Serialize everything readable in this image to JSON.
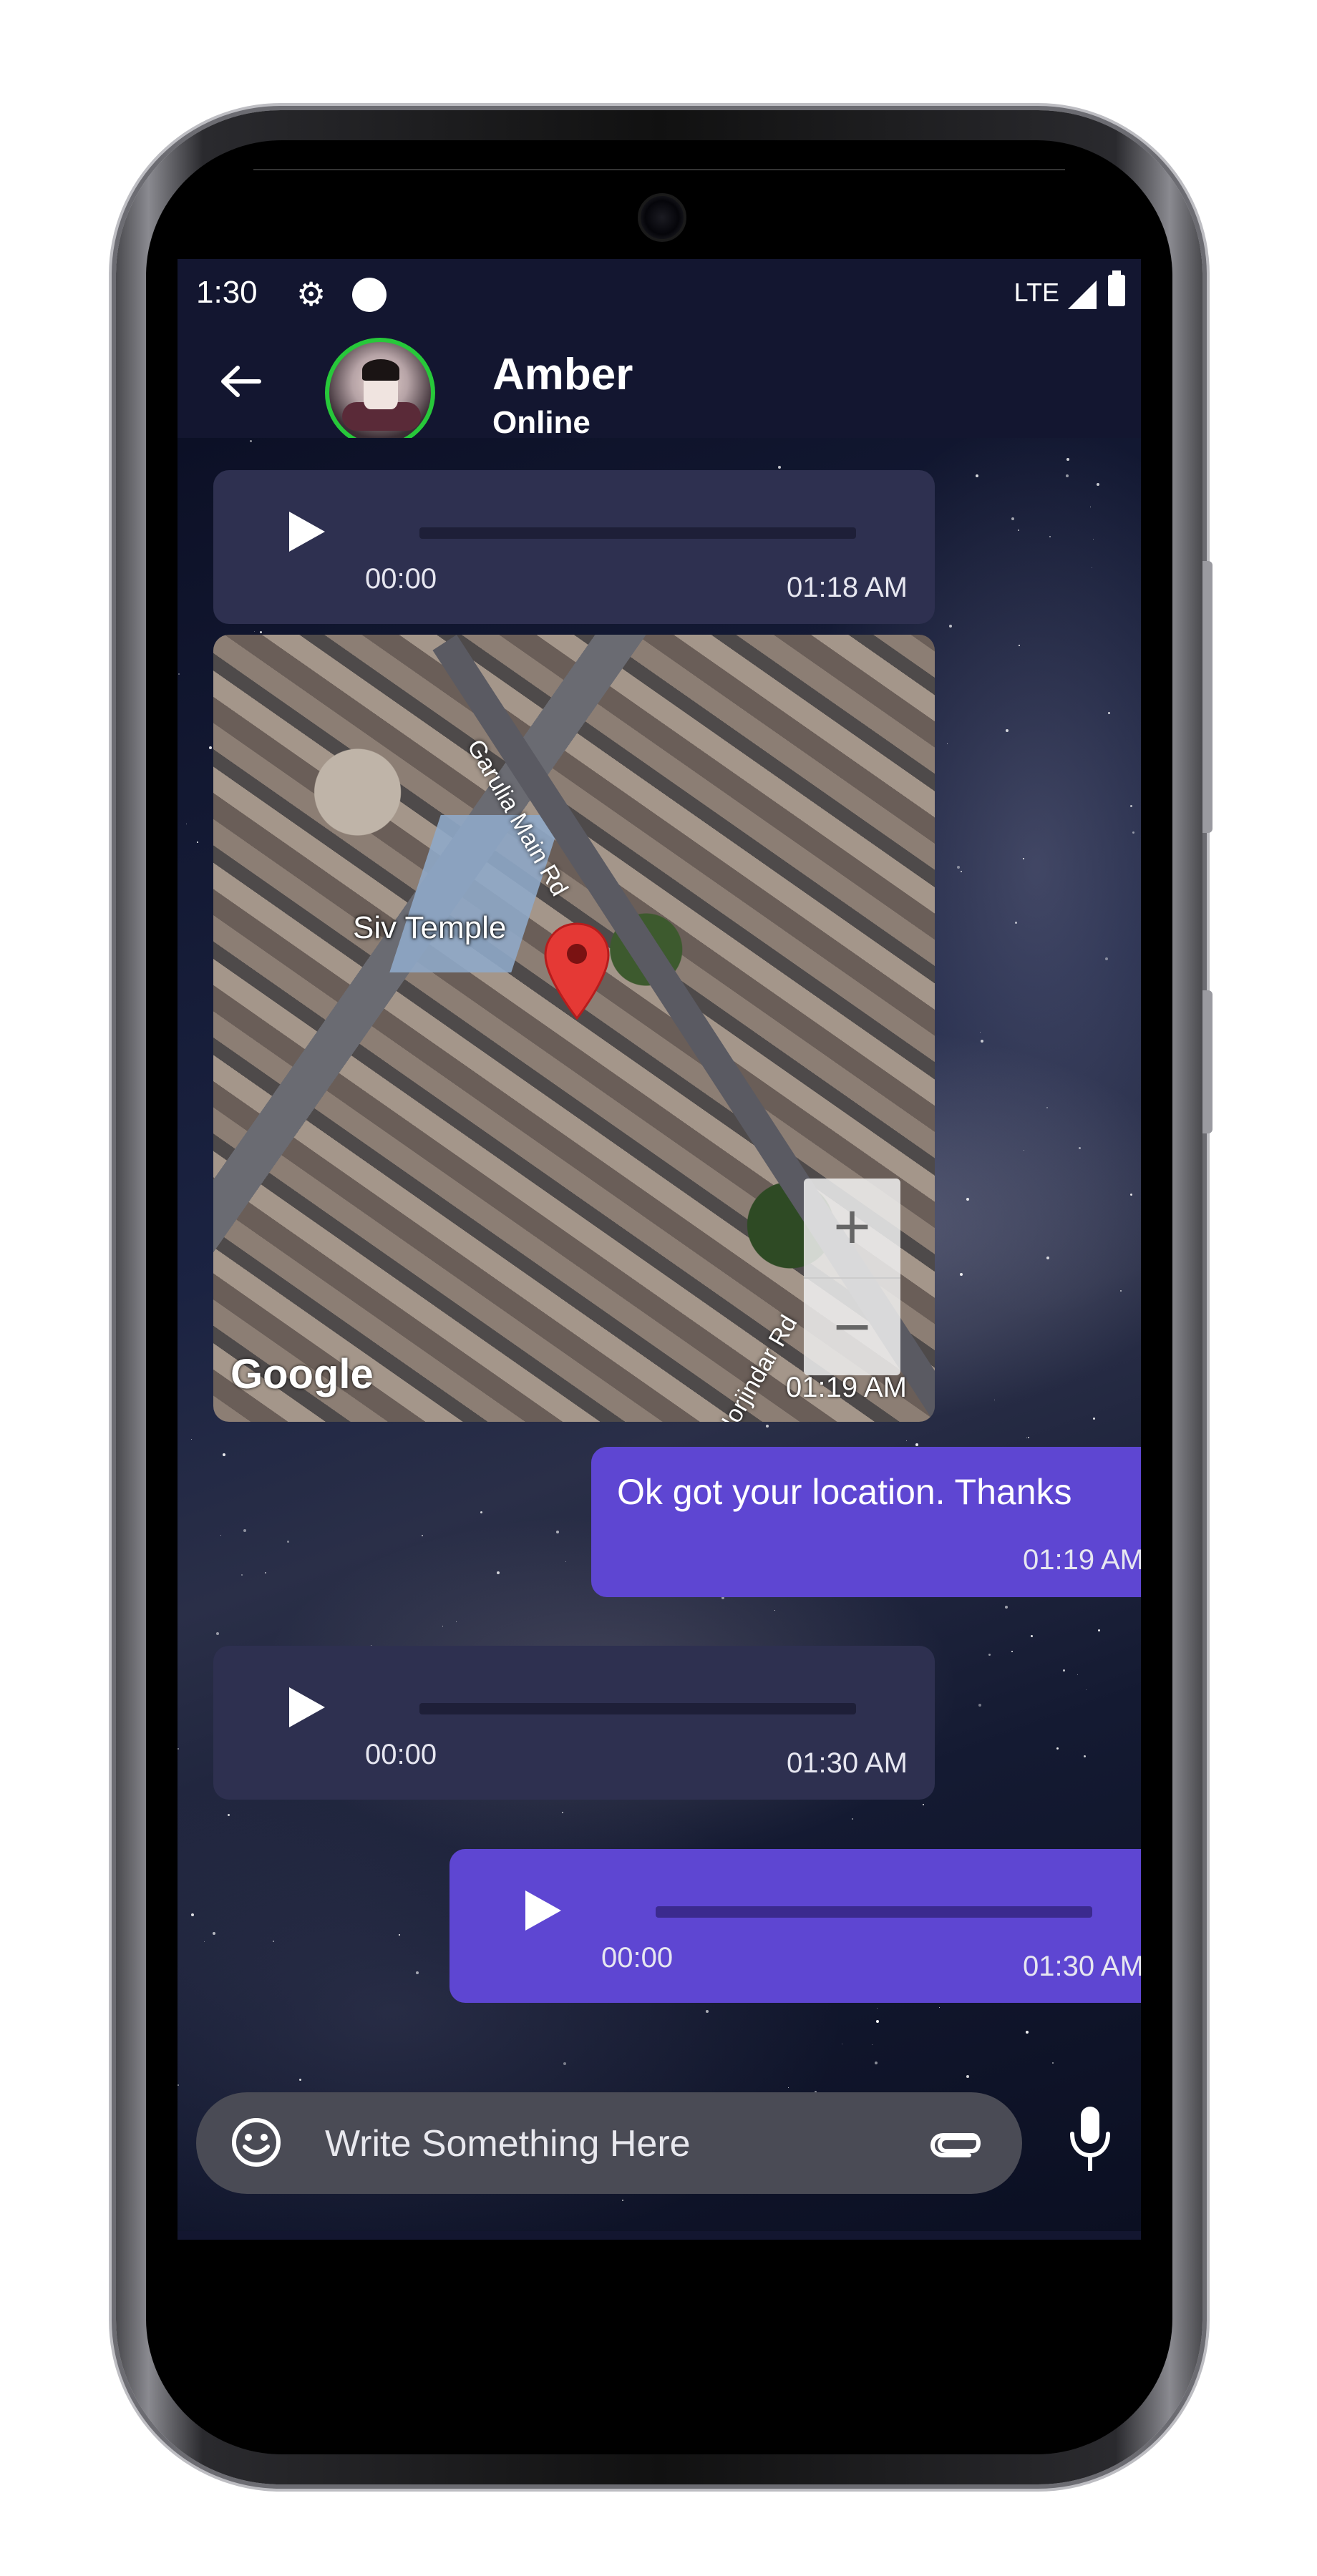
{
  "status_bar": {
    "time": "1:30",
    "network": "LTE"
  },
  "header": {
    "contact_name": "Amber",
    "contact_status": "Online"
  },
  "messages": [
    {
      "type": "voice",
      "direction": "incoming",
      "duration": "00:00",
      "time": "01:18 AM"
    },
    {
      "type": "location",
      "direction": "incoming",
      "place_label": "Siv Temple",
      "road_1": "Garulia Main Rd",
      "road_2": "Horjindar Rd",
      "map_provider": "Google",
      "time": "01:19 AM"
    },
    {
      "type": "text",
      "direction": "outgoing",
      "text": "Ok got your location. Thanks",
      "time": "01:19 AM"
    },
    {
      "type": "voice",
      "direction": "incoming",
      "duration": "00:00",
      "time": "01:30 AM"
    },
    {
      "type": "voice",
      "direction": "outgoing",
      "duration": "00:00",
      "time": "01:30 AM"
    }
  ],
  "composer": {
    "placeholder": "Write Something Here"
  },
  "colors": {
    "incoming_bubble": "#2e3050",
    "outgoing_bubble": "#5e46d2",
    "header": "#131630",
    "online_ring": "#27c83a"
  },
  "icons": {
    "back": "arrow-left-icon",
    "settings": "gear-icon",
    "emoji": "emoji-icon",
    "attach": "paperclip-icon",
    "mic": "microphone-icon",
    "play": "play-icon"
  }
}
